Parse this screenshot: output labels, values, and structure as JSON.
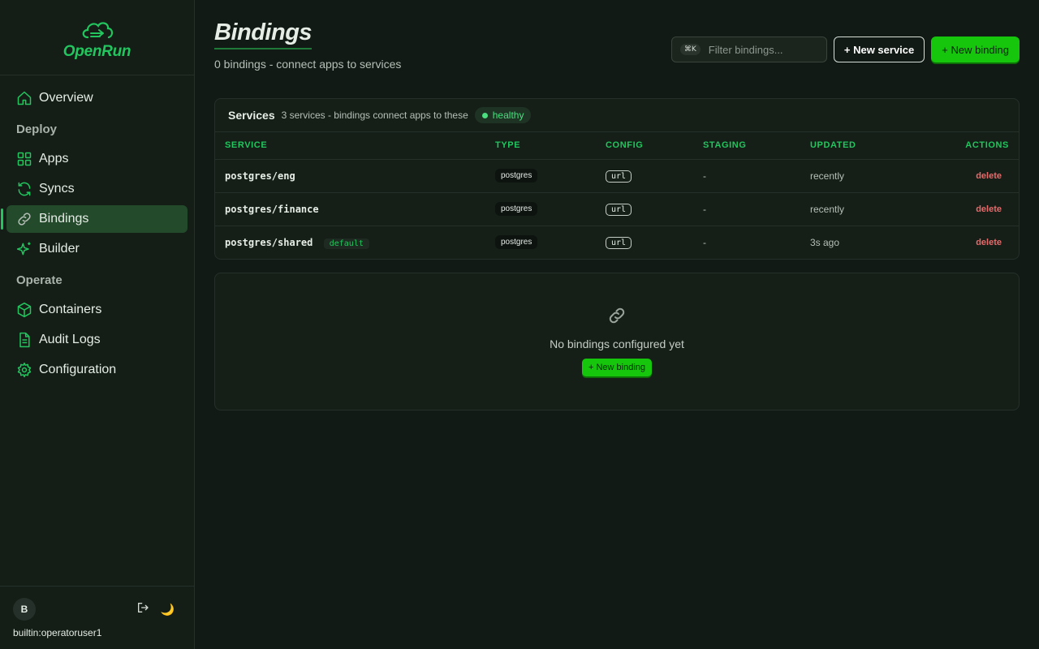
{
  "brand": {
    "name": "OpenRun"
  },
  "sidebar": {
    "items": [
      {
        "label": "Overview",
        "icon": "home-icon"
      },
      {
        "section": "Deploy"
      },
      {
        "label": "Apps",
        "icon": "grid-icon"
      },
      {
        "label": "Syncs",
        "icon": "refresh-icon"
      },
      {
        "label": "Bindings",
        "icon": "link-icon",
        "active": true
      },
      {
        "label": "Builder",
        "icon": "sparkle-icon"
      },
      {
        "section": "Operate"
      },
      {
        "label": "Containers",
        "icon": "box-icon"
      },
      {
        "label": "Audit Logs",
        "icon": "document-icon"
      },
      {
        "label": "Configuration",
        "icon": "gear-icon"
      }
    ],
    "footer": {
      "avatar_initial": "B",
      "username": "builtin:operatoruser1",
      "theme_glyph": "🌙"
    }
  },
  "header": {
    "title": "Bindings",
    "subtitle": "0 bindings - connect apps to services",
    "filter_shortcut": "⌘K",
    "filter_placeholder": "Filter bindings...",
    "new_service_label": "+ New service",
    "new_binding_label": "+ New binding"
  },
  "services": {
    "title": "Services",
    "description": "3 services - bindings connect apps to these",
    "status": "healthy",
    "columns": [
      "SERVICE",
      "TYPE",
      "CONFIG",
      "STAGING",
      "UPDATED",
      "ACTIONS"
    ],
    "rows": [
      {
        "service": "postgres/eng",
        "badge": "",
        "type": "postgres",
        "config": "url",
        "staging": "-",
        "updated": "recently",
        "action": "delete"
      },
      {
        "service": "postgres/finance",
        "badge": "",
        "type": "postgres",
        "config": "url",
        "staging": "-",
        "updated": "recently",
        "action": "delete"
      },
      {
        "service": "postgres/shared",
        "badge": "default",
        "type": "postgres",
        "config": "url",
        "staging": "-",
        "updated": "3s ago",
        "action": "delete"
      }
    ]
  },
  "empty_state": {
    "icon": "🔗",
    "message": "No bindings configured yet",
    "button_label": "+ New binding"
  },
  "colors": {
    "accent": "#22c55e",
    "button_green": "#16c60c",
    "danger": "#e86a6a",
    "background": "#111a14"
  }
}
